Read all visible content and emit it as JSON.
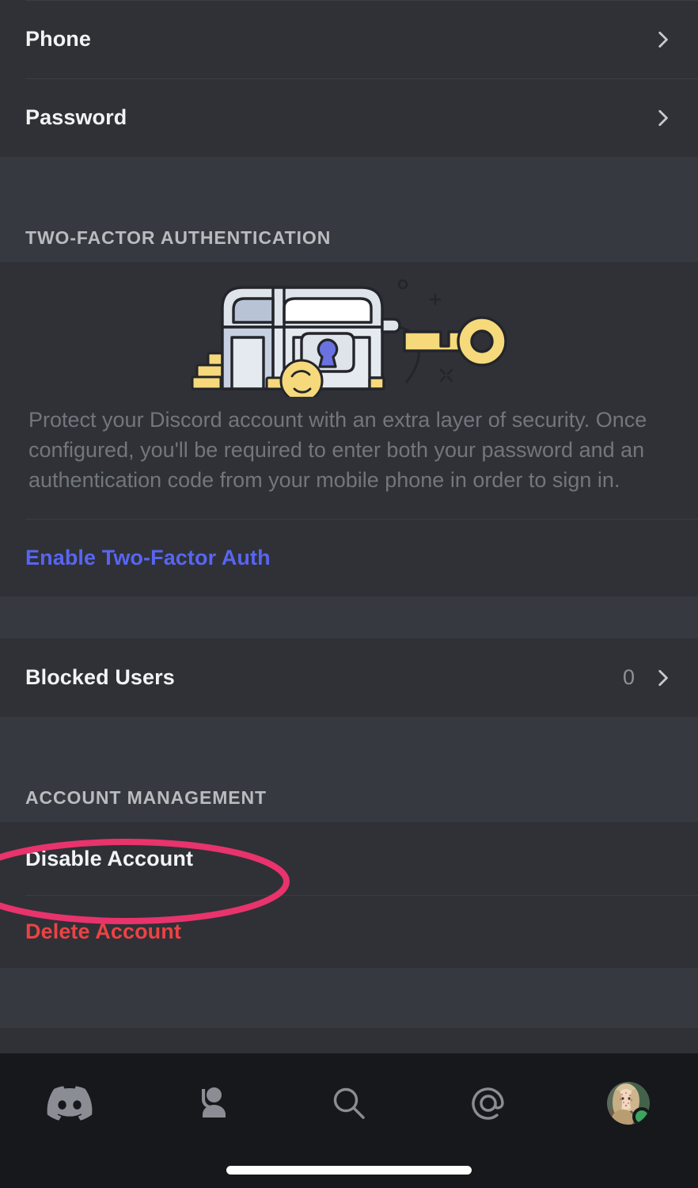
{
  "screen": {
    "name": "Discord Account Settings",
    "background": "#2f3136",
    "section_band_color": "#36393f",
    "accent_blurple": "#5865f2",
    "danger_red": "#ed4245",
    "annotation_color": "#e8336d"
  },
  "account_rows": [
    {
      "label": "Phone",
      "value": "",
      "chevron": "chevron-right-icon"
    },
    {
      "label": "Password",
      "value": "",
      "chevron": "chevron-right-icon"
    }
  ],
  "two_factor": {
    "section_title": "TWO-FACTOR AUTHENTICATION",
    "illustration": "treasure-chest-key-illustration",
    "description": "Protect your Discord account with an extra layer of security. Once configured, you'll be required to enter both your password and an authentication code from your mobile phone in order to sign in.",
    "enable_label": "Enable Two-Factor Auth"
  },
  "blocked": {
    "label": "Blocked Users",
    "count": "0",
    "chevron": "chevron-right-icon"
  },
  "account_management": {
    "section_title": "ACCOUNT MANAGEMENT",
    "disable_label": "Disable Account",
    "delete_label": "Delete Account"
  },
  "annotation": {
    "shape": "ellipse",
    "targets": "Disable Account",
    "color": "#e8336d"
  },
  "bottom_nav": {
    "items": [
      {
        "name": "servers-tab",
        "icon": "discord-logo-icon"
      },
      {
        "name": "friends-tab",
        "icon": "friends-wave-icon"
      },
      {
        "name": "search-tab",
        "icon": "search-icon"
      },
      {
        "name": "mentions-tab",
        "icon": "at-mention-icon"
      },
      {
        "name": "profile-tab",
        "icon": "avatar",
        "status": "online"
      }
    ]
  }
}
